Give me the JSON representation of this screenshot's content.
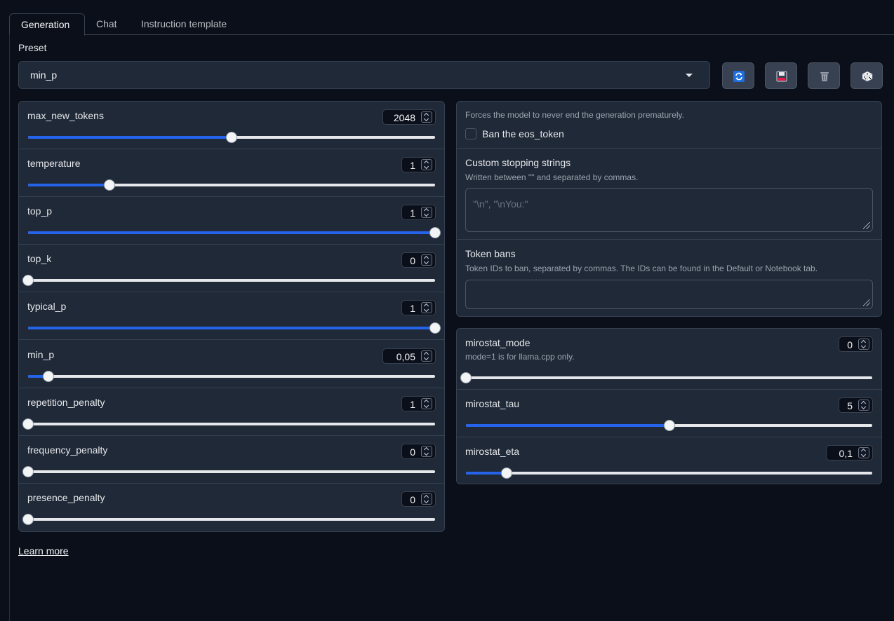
{
  "tabs": [
    "Generation",
    "Chat",
    "Instruction template"
  ],
  "preset": {
    "label": "Preset",
    "value": "min_p"
  },
  "toolbar": [
    {
      "icon": "refresh-icon",
      "color": "#1d6fe0"
    },
    {
      "icon": "save-icon",
      "color": "#e11d48"
    },
    {
      "icon": "trash-icon",
      "color": "#9ca3af"
    },
    {
      "icon": "dice-icon",
      "color": "#f3f4f6"
    }
  ],
  "params": [
    {
      "name": "max_new_tokens",
      "value": "2048",
      "fraction": 0.5
    },
    {
      "name": "temperature",
      "value": "1",
      "fraction": 0.2
    },
    {
      "name": "top_p",
      "value": "1",
      "fraction": 1.0
    },
    {
      "name": "top_k",
      "value": "0",
      "fraction": 0.0
    },
    {
      "name": "typical_p",
      "value": "1",
      "fraction": 1.0
    },
    {
      "name": "min_p",
      "value": "0,05",
      "fraction": 0.05
    },
    {
      "name": "repetition_penalty",
      "value": "1",
      "fraction": 0.0
    },
    {
      "name": "frequency_penalty",
      "value": "0",
      "fraction": 0.0
    },
    {
      "name": "presence_penalty",
      "value": "0",
      "fraction": 0.0
    }
  ],
  "ban_eos": {
    "info": "Forces the model to never end the generation prematurely.",
    "label": "Ban the eos_token",
    "checked": false
  },
  "stopping": {
    "title": "Custom stopping strings",
    "info": "Written between \"\" and separated by commas.",
    "placeholder": "\"\\n\", \"\\nYou:\""
  },
  "token_bans": {
    "title": "Token bans",
    "info": "Token IDs to ban, separated by commas. The IDs can be found in the Default or Notebook tab."
  },
  "mirostat": [
    {
      "name": "mirostat_mode",
      "value": "0",
      "info": "mode=1 is for llama.cpp only.",
      "fraction": 0.0
    },
    {
      "name": "mirostat_tau",
      "value": "5",
      "fraction": 0.5
    },
    {
      "name": "mirostat_eta",
      "value": "0,1",
      "fraction": 0.1
    }
  ],
  "learn_more": "Learn more"
}
